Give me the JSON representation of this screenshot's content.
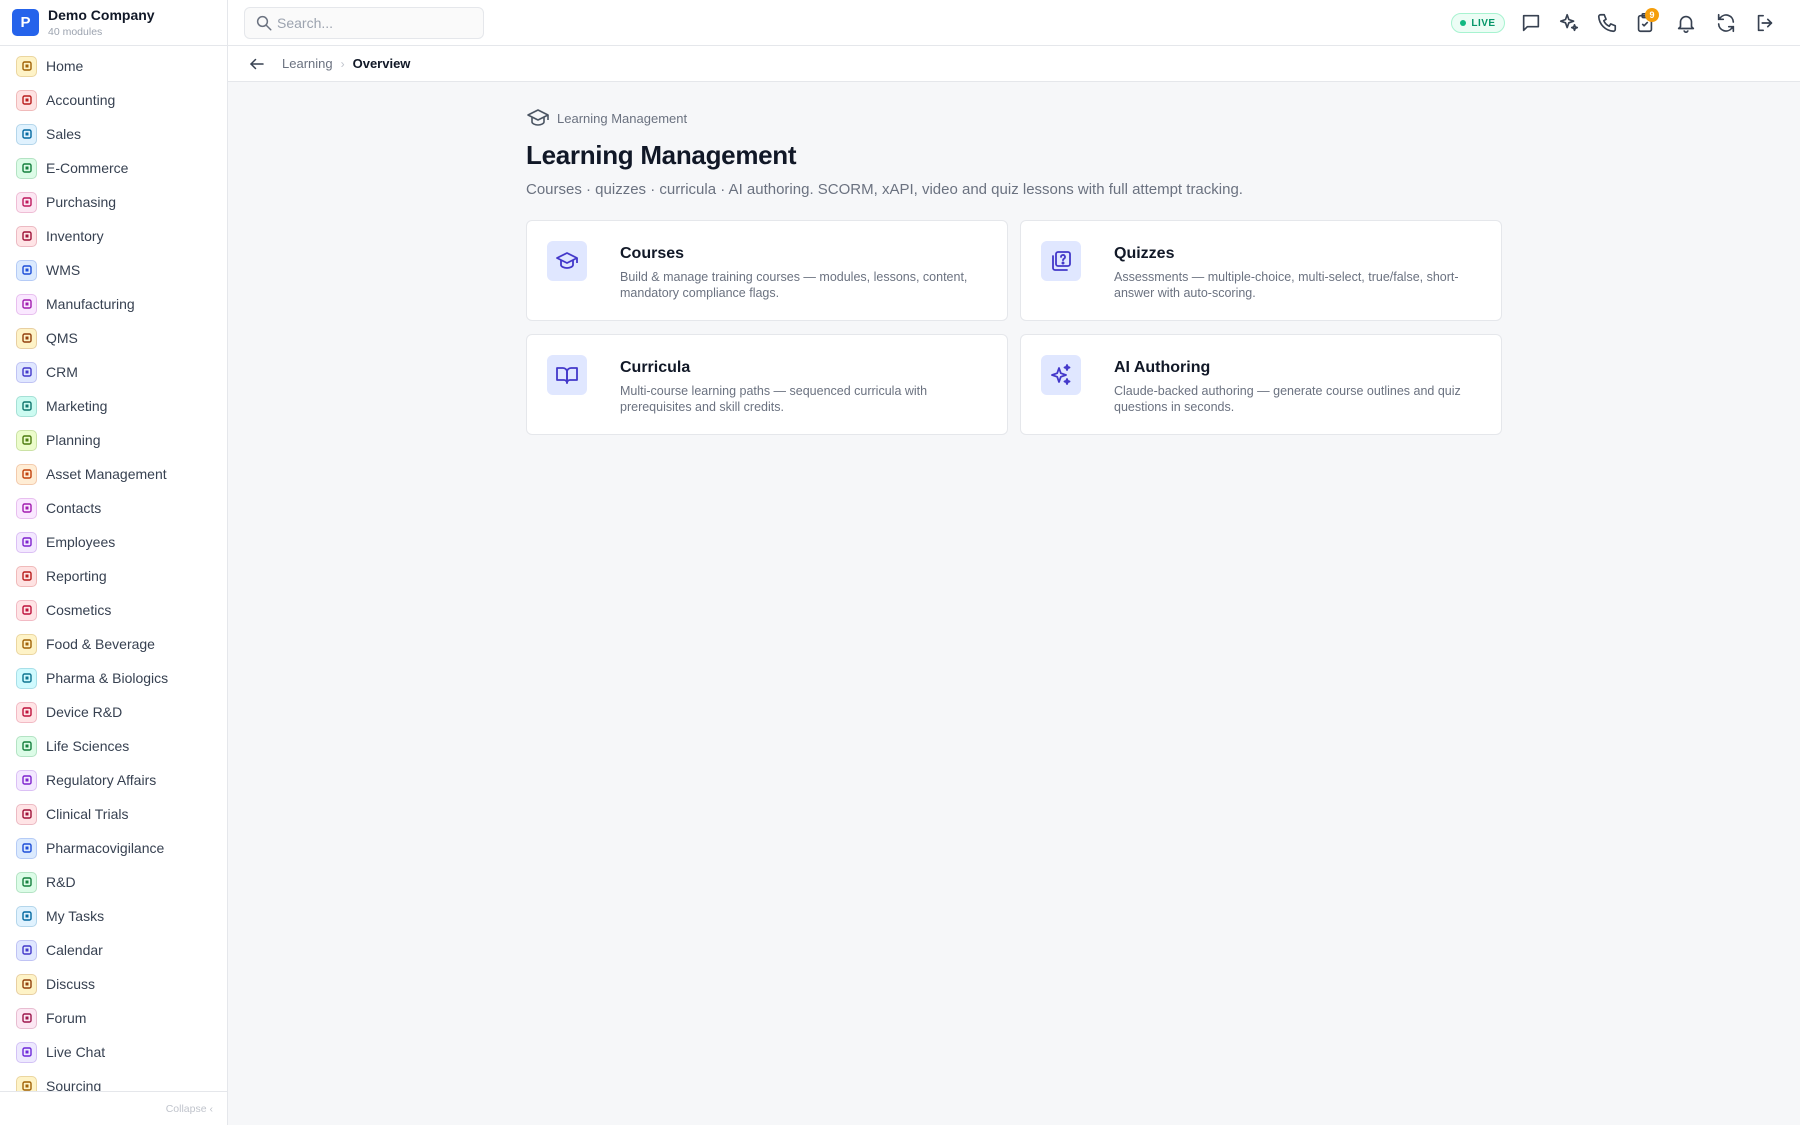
{
  "brand": {
    "logo_letter": "P",
    "name": "Demo Company",
    "subtitle": "40 modules",
    "color": "#2563eb"
  },
  "sidebar": {
    "items": [
      {
        "label": "Home",
        "icon": "grid-icon",
        "color": "#a16207",
        "bg": "#fef3c7"
      },
      {
        "label": "Accounting",
        "icon": "bank-icon",
        "color": "#b91c1c",
        "bg": "#fee2e2"
      },
      {
        "label": "Sales",
        "icon": "person-icon",
        "color": "#0369a1",
        "bg": "#e0f2fe"
      },
      {
        "label": "E-Commerce",
        "icon": "store-icon",
        "color": "#15803d",
        "bg": "#dcfce7"
      },
      {
        "label": "Purchasing",
        "icon": "cart-icon",
        "color": "#be185d",
        "bg": "#fce7f3"
      },
      {
        "label": "Inventory",
        "icon": "box-icon",
        "color": "#9f1239",
        "bg": "#ffe4e6"
      },
      {
        "label": "WMS",
        "icon": "warehouse-icon",
        "color": "#1d4ed8",
        "bg": "#dbeafe"
      },
      {
        "label": "Manufacturing",
        "icon": "factory-icon",
        "color": "#a21caf",
        "bg": "#fae8ff"
      },
      {
        "label": "QMS",
        "icon": "badge-check-icon",
        "color": "#92400e",
        "bg": "#fef3c7"
      },
      {
        "label": "CRM",
        "icon": "users-icon",
        "color": "#4338ca",
        "bg": "#e0e7ff"
      },
      {
        "label": "Marketing",
        "icon": "megaphone-icon",
        "color": "#0f766e",
        "bg": "#ccfbf1"
      },
      {
        "label": "Planning",
        "icon": "calendar-icon",
        "color": "#4d7c0f",
        "bg": "#ecfccb"
      },
      {
        "label": "Asset Management",
        "icon": "tools-icon",
        "color": "#c2410c",
        "bg": "#ffedd5"
      },
      {
        "label": "Contacts",
        "icon": "contact-icon",
        "color": "#a21caf",
        "bg": "#fae8ff"
      },
      {
        "label": "Employees",
        "icon": "briefcase-icon",
        "color": "#7e22ce",
        "bg": "#f3e8ff"
      },
      {
        "label": "Reporting",
        "icon": "bar-chart-icon",
        "color": "#b91c1c",
        "bg": "#fee2e2"
      },
      {
        "label": "Cosmetics",
        "icon": "flower-icon",
        "color": "#be123c",
        "bg": "#ffe4e6"
      },
      {
        "label": "Food & Beverage",
        "icon": "utensils-icon",
        "color": "#a16207",
        "bg": "#fef3c7"
      },
      {
        "label": "Pharma & Biologics",
        "icon": "pill-bottle-icon",
        "color": "#0e7490",
        "bg": "#cffafe"
      },
      {
        "label": "Device R&D",
        "icon": "cog-icon",
        "color": "#be123c",
        "bg": "#ffe4e6"
      },
      {
        "label": "Life Sciences",
        "icon": "microscope-icon",
        "color": "#15803d",
        "bg": "#dcfce7"
      },
      {
        "label": "Regulatory Affairs",
        "icon": "gavel-icon",
        "color": "#7e22ce",
        "bg": "#f3e8ff"
      },
      {
        "label": "Clinical Trials",
        "icon": "clipboard-icon",
        "color": "#9f1239",
        "bg": "#ffe4e6"
      },
      {
        "label": "Pharmacovigilance",
        "icon": "shield-icon",
        "color": "#1d4ed8",
        "bg": "#dbeafe"
      },
      {
        "label": "R&D",
        "icon": "flask-icon",
        "color": "#15803d",
        "bg": "#dcfce7"
      },
      {
        "label": "My Tasks",
        "icon": "checklist-icon",
        "color": "#0369a1",
        "bg": "#e0f2fe"
      },
      {
        "label": "Calendar",
        "icon": "calendar-icon",
        "color": "#4338ca",
        "bg": "#e0e7ff"
      },
      {
        "label": "Discuss",
        "icon": "chat-icon",
        "color": "#92400e",
        "bg": "#fef3c7"
      },
      {
        "label": "Forum",
        "icon": "forum-icon",
        "color": "#9d174d",
        "bg": "#fce7f3"
      },
      {
        "label": "Live Chat",
        "icon": "headset-icon",
        "color": "#6d28d9",
        "bg": "#ede9fe"
      },
      {
        "label": "Sourcing",
        "icon": "search-icon",
        "color": "#a16207",
        "bg": "#fef3c7"
      }
    ],
    "collapse_label": "Collapse ‹"
  },
  "topbar": {
    "search_placeholder": "Search...",
    "live_label": "LIVE",
    "icons": [
      "message-icon",
      "sparkles-icon",
      "phone-icon",
      "clipboard-icon",
      "bell-icon",
      "refresh-icon",
      "logout-icon"
    ],
    "clipboard_badge": "9"
  },
  "breadcrumb": {
    "parent": "Learning",
    "separator": "›",
    "current": "Overview"
  },
  "main": {
    "eyebrow": "Learning Management",
    "title": "Learning Management",
    "description": "Courses · quizzes · curricula · AI authoring. SCORM, xAPI, video and quiz lessons with full attempt tracking.",
    "cards": [
      {
        "title": "Courses",
        "icon": "graduation-cap-icon",
        "description": "Build & manage training courses — modules, lessons, content, mandatory compliance flags."
      },
      {
        "title": "Quizzes",
        "icon": "quiz-icon",
        "description": "Assessments — multiple-choice, multi-select, true/false, short-answer with auto-scoring."
      },
      {
        "title": "Curricula",
        "icon": "open-book-icon",
        "description": "Multi-course learning paths — sequenced curricula with prerequisites and skill credits."
      },
      {
        "title": "AI Authoring",
        "icon": "sparkles-icon",
        "description": "Claude-backed authoring — generate course outlines and quiz questions in seconds."
      }
    ]
  },
  "colors": {
    "accent": "#4338ca",
    "accent_bg": "#e0e7ff",
    "live": "#059669",
    "badge": "#f59e0b"
  }
}
